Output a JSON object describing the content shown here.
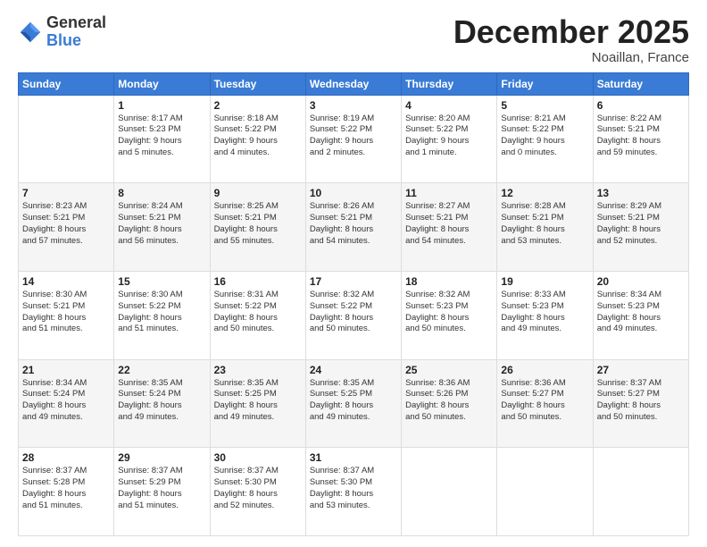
{
  "header": {
    "logo_general": "General",
    "logo_blue": "Blue",
    "month": "December 2025",
    "location": "Noaillan, France"
  },
  "days_of_week": [
    "Sunday",
    "Monday",
    "Tuesday",
    "Wednesday",
    "Thursday",
    "Friday",
    "Saturday"
  ],
  "weeks": [
    [
      {
        "day": "",
        "text": ""
      },
      {
        "day": "1",
        "text": "Sunrise: 8:17 AM\nSunset: 5:23 PM\nDaylight: 9 hours\nand 5 minutes."
      },
      {
        "day": "2",
        "text": "Sunrise: 8:18 AM\nSunset: 5:22 PM\nDaylight: 9 hours\nand 4 minutes."
      },
      {
        "day": "3",
        "text": "Sunrise: 8:19 AM\nSunset: 5:22 PM\nDaylight: 9 hours\nand 2 minutes."
      },
      {
        "day": "4",
        "text": "Sunrise: 8:20 AM\nSunset: 5:22 PM\nDaylight: 9 hours\nand 1 minute."
      },
      {
        "day": "5",
        "text": "Sunrise: 8:21 AM\nSunset: 5:22 PM\nDaylight: 9 hours\nand 0 minutes."
      },
      {
        "day": "6",
        "text": "Sunrise: 8:22 AM\nSunset: 5:21 PM\nDaylight: 8 hours\nand 59 minutes."
      }
    ],
    [
      {
        "day": "7",
        "text": "Sunrise: 8:23 AM\nSunset: 5:21 PM\nDaylight: 8 hours\nand 57 minutes."
      },
      {
        "day": "8",
        "text": "Sunrise: 8:24 AM\nSunset: 5:21 PM\nDaylight: 8 hours\nand 56 minutes."
      },
      {
        "day": "9",
        "text": "Sunrise: 8:25 AM\nSunset: 5:21 PM\nDaylight: 8 hours\nand 55 minutes."
      },
      {
        "day": "10",
        "text": "Sunrise: 8:26 AM\nSunset: 5:21 PM\nDaylight: 8 hours\nand 54 minutes."
      },
      {
        "day": "11",
        "text": "Sunrise: 8:27 AM\nSunset: 5:21 PM\nDaylight: 8 hours\nand 54 minutes."
      },
      {
        "day": "12",
        "text": "Sunrise: 8:28 AM\nSunset: 5:21 PM\nDaylight: 8 hours\nand 53 minutes."
      },
      {
        "day": "13",
        "text": "Sunrise: 8:29 AM\nSunset: 5:21 PM\nDaylight: 8 hours\nand 52 minutes."
      }
    ],
    [
      {
        "day": "14",
        "text": "Sunrise: 8:30 AM\nSunset: 5:21 PM\nDaylight: 8 hours\nand 51 minutes."
      },
      {
        "day": "15",
        "text": "Sunrise: 8:30 AM\nSunset: 5:22 PM\nDaylight: 8 hours\nand 51 minutes."
      },
      {
        "day": "16",
        "text": "Sunrise: 8:31 AM\nSunset: 5:22 PM\nDaylight: 8 hours\nand 50 minutes."
      },
      {
        "day": "17",
        "text": "Sunrise: 8:32 AM\nSunset: 5:22 PM\nDaylight: 8 hours\nand 50 minutes."
      },
      {
        "day": "18",
        "text": "Sunrise: 8:32 AM\nSunset: 5:23 PM\nDaylight: 8 hours\nand 50 minutes."
      },
      {
        "day": "19",
        "text": "Sunrise: 8:33 AM\nSunset: 5:23 PM\nDaylight: 8 hours\nand 49 minutes."
      },
      {
        "day": "20",
        "text": "Sunrise: 8:34 AM\nSunset: 5:23 PM\nDaylight: 8 hours\nand 49 minutes."
      }
    ],
    [
      {
        "day": "21",
        "text": "Sunrise: 8:34 AM\nSunset: 5:24 PM\nDaylight: 8 hours\nand 49 minutes."
      },
      {
        "day": "22",
        "text": "Sunrise: 8:35 AM\nSunset: 5:24 PM\nDaylight: 8 hours\nand 49 minutes."
      },
      {
        "day": "23",
        "text": "Sunrise: 8:35 AM\nSunset: 5:25 PM\nDaylight: 8 hours\nand 49 minutes."
      },
      {
        "day": "24",
        "text": "Sunrise: 8:35 AM\nSunset: 5:25 PM\nDaylight: 8 hours\nand 49 minutes."
      },
      {
        "day": "25",
        "text": "Sunrise: 8:36 AM\nSunset: 5:26 PM\nDaylight: 8 hours\nand 50 minutes."
      },
      {
        "day": "26",
        "text": "Sunrise: 8:36 AM\nSunset: 5:27 PM\nDaylight: 8 hours\nand 50 minutes."
      },
      {
        "day": "27",
        "text": "Sunrise: 8:37 AM\nSunset: 5:27 PM\nDaylight: 8 hours\nand 50 minutes."
      }
    ],
    [
      {
        "day": "28",
        "text": "Sunrise: 8:37 AM\nSunset: 5:28 PM\nDaylight: 8 hours\nand 51 minutes."
      },
      {
        "day": "29",
        "text": "Sunrise: 8:37 AM\nSunset: 5:29 PM\nDaylight: 8 hours\nand 51 minutes."
      },
      {
        "day": "30",
        "text": "Sunrise: 8:37 AM\nSunset: 5:30 PM\nDaylight: 8 hours\nand 52 minutes."
      },
      {
        "day": "31",
        "text": "Sunrise: 8:37 AM\nSunset: 5:30 PM\nDaylight: 8 hours\nand 53 minutes."
      },
      {
        "day": "",
        "text": ""
      },
      {
        "day": "",
        "text": ""
      },
      {
        "day": "",
        "text": ""
      }
    ]
  ]
}
